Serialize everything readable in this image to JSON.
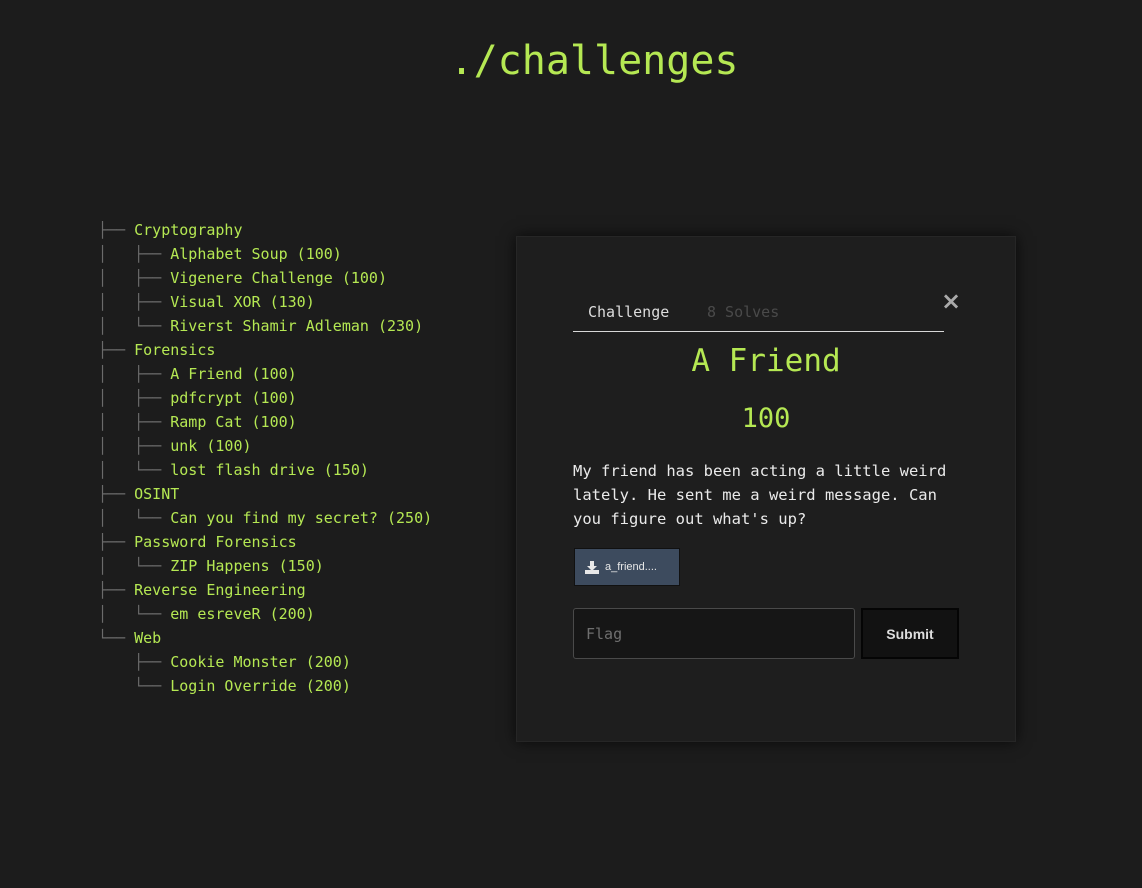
{
  "page": {
    "title": "./challenges"
  },
  "tree": {
    "categories": [
      {
        "name": "Cryptography",
        "challenges": [
          "Alphabet Soup (100)",
          "Vigenere Challenge (100)",
          "Visual XOR (130)",
          "Riverst Shamir Adleman (230)"
        ]
      },
      {
        "name": "Forensics",
        "challenges": [
          "A Friend (100)",
          "pdfcrypt (100)",
          "Ramp Cat (100)",
          "unk (100)",
          "lost flash drive (150)"
        ]
      },
      {
        "name": "OSINT",
        "challenges": [
          "Can you find my secret? (250)"
        ]
      },
      {
        "name": "Password Forensics",
        "challenges": [
          "ZIP Happens (150)"
        ]
      },
      {
        "name": "Reverse Engineering",
        "challenges": [
          "em esreveR (200)"
        ]
      },
      {
        "name": "Web",
        "challenges": [
          "Cookie Monster (200)",
          "Login Override (200)"
        ]
      }
    ]
  },
  "modal": {
    "close_label": "×",
    "tabs": {
      "challenge": "Challenge",
      "solves": "8 Solves"
    },
    "name": "A Friend",
    "value": "100",
    "description": "My friend has been acting a little weird lately. He sent me a weird message. Can you figure out what's up?",
    "file": {
      "label": "a_friend....",
      "icon": "download-icon"
    },
    "flag_input": {
      "placeholder": "Flag",
      "value": ""
    },
    "submit_label": "Submit"
  },
  "colors": {
    "background": "#1c1c1c",
    "accent": "#b5e853",
    "modal_background": "#1e1e1e",
    "file_button": "#3d4b5e"
  }
}
